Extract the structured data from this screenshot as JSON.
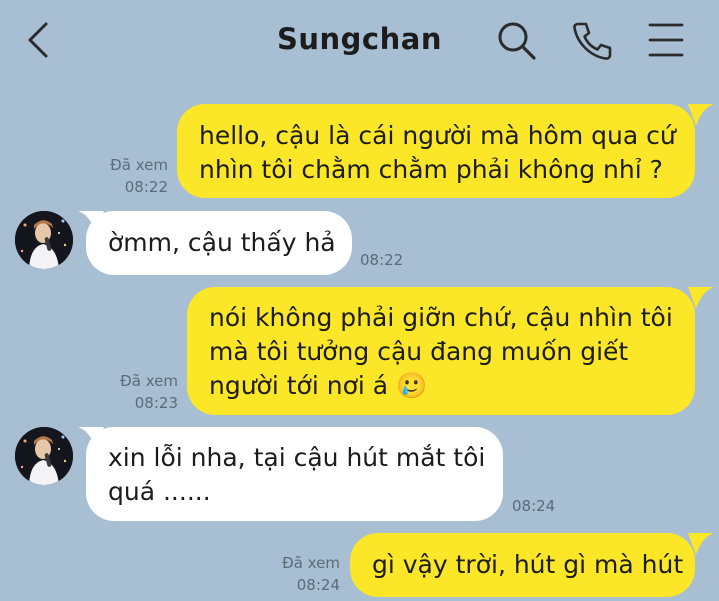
{
  "header": {
    "title": "Sungchan",
    "back_icon": "chevron-left-icon",
    "search_icon": "search-icon",
    "call_icon": "phone-icon",
    "menu_icon": "menu-icon"
  },
  "colors": {
    "background": "#a8bed2",
    "sent_bubble": "#fbe627",
    "received_bubble": "#ffffff"
  },
  "messages": [
    {
      "side": "sent",
      "lines": [
        "hello, cậu là cái người mà hôm qua cứ",
        "nhìn tôi chằm chằm phải không nhỉ ?"
      ],
      "read": "Đã xem",
      "time": "08:22"
    },
    {
      "side": "received",
      "lines": [
        "ờmm, cậu thấy hả"
      ],
      "time": "08:22"
    },
    {
      "side": "sent",
      "lines": [
        "nói không phải giỡn chứ, cậu nhìn tôi",
        "mà tôi tưởng cậu đang muốn giết",
        "người tới nơi á 🥲"
      ],
      "read": "Đã xem",
      "time": "08:23"
    },
    {
      "side": "received",
      "lines": [
        "xin lỗi nha, tại cậu hút mắt tôi",
        "quá ......"
      ],
      "time": "08:24"
    },
    {
      "side": "sent",
      "lines": [
        "gì vậy trời, hút gì mà hút"
      ],
      "read": "Đã xem",
      "time": "08:24"
    }
  ]
}
